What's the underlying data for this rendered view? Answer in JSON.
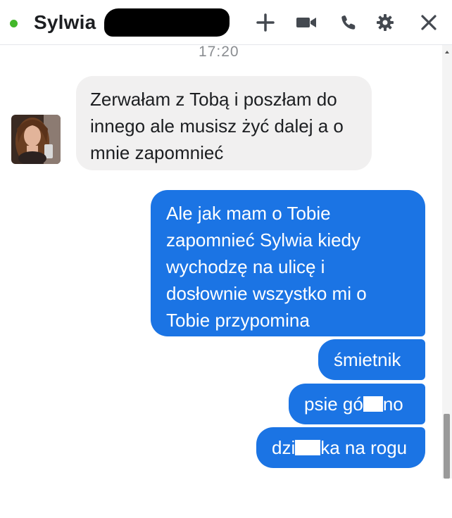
{
  "header": {
    "name": "Sylwia",
    "status_color": "#42b72a",
    "icons": [
      "plus-icon",
      "video-camera-icon",
      "phone-icon",
      "gear-icon",
      "close-icon"
    ]
  },
  "timestamp": "17:20",
  "messages": {
    "incoming_1": "Zerwałam z Tobą i poszłam do innego ale musisz żyć dalej a o mnie zapomnieć",
    "outgoing_1": "Ale jak mam o Tobie zapomnieć Sylwia kiedy wychodzę na ulicę i dosłownie wszystko mi o Tobie przypomina",
    "outgoing_2": "śmietnik",
    "outgoing_3_start": "psie gó",
    "outgoing_3_end": "no",
    "outgoing_4_start": "dzi",
    "outgoing_4_end": "ka na rogu"
  },
  "colors": {
    "outgoing_bubble": "#1b74e4",
    "incoming_bubble": "#f1f0f0"
  }
}
